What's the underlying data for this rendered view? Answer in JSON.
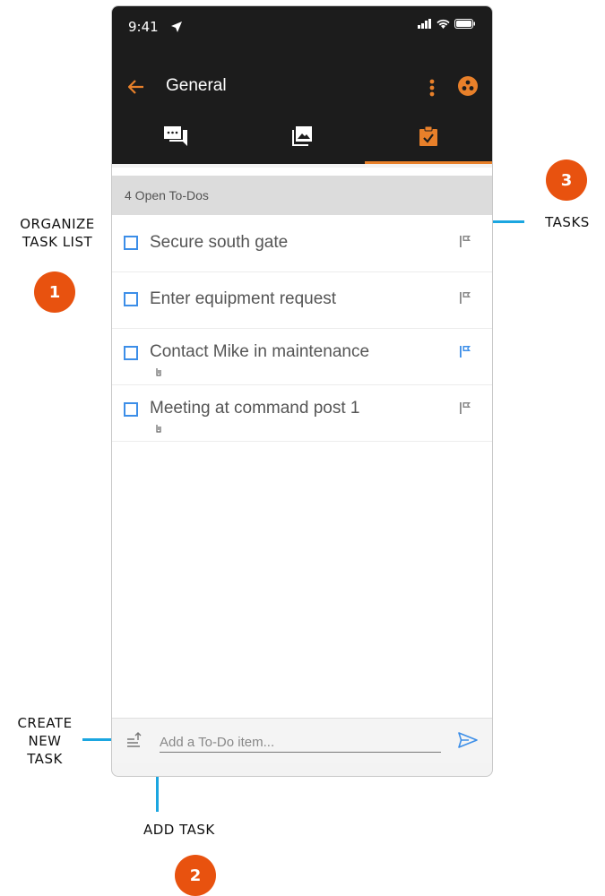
{
  "colors": {
    "accent": "#e8802a",
    "callout": "#e8520f",
    "line": "#1ba6e0",
    "checkbox": "#3c8ee8"
  },
  "status_bar": {
    "time": "9:41"
  },
  "header": {
    "title": "General"
  },
  "tabs": [
    {
      "icon": "chat-icon",
      "active": false
    },
    {
      "icon": "gallery-icon",
      "active": false
    },
    {
      "icon": "clipboard-check-icon",
      "active": true
    }
  ],
  "section": {
    "label": "4 Open To-Dos"
  },
  "tasks": [
    {
      "label": "Secure south gate",
      "has_attachment": false,
      "flag_color": "#888888"
    },
    {
      "label": "Enter equipment request",
      "has_attachment": false,
      "flag_color": "#888888"
    },
    {
      "label": "Contact Mike in maintenance",
      "has_attachment": true,
      "flag_color": "#3c8ee8"
    },
    {
      "label": "Meeting at command post 1",
      "has_attachment": true,
      "flag_color": "#888888"
    }
  ],
  "composer": {
    "placeholder": "Add a To-Do item..."
  },
  "callouts": {
    "organize": {
      "text_line1": "ORGANIZE",
      "text_line2": "TASK LIST",
      "number": "1"
    },
    "add_task": {
      "text": "ADD TASK",
      "number": "2"
    },
    "tasks": {
      "text": "TASKS",
      "number": "3"
    },
    "create": {
      "line1": "CREATE",
      "line2": "NEW",
      "line3": "TASK"
    }
  }
}
